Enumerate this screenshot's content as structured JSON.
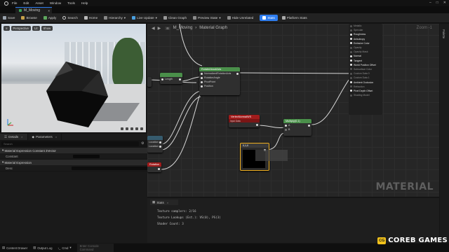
{
  "menu": {
    "items": [
      "File",
      "Edit",
      "Asset",
      "Window",
      "Tools",
      "Help"
    ]
  },
  "window": {
    "controls": [
      "–",
      "□",
      "✕"
    ]
  },
  "document_tab": {
    "label": "M_Moving",
    "close": "×"
  },
  "toolbar": {
    "save": "Save",
    "browse": "Browse",
    "apply": "Apply",
    "search": "Search",
    "home": "Home",
    "hierarchy": "Hierarchy",
    "live_update": "Live Update",
    "clean_graph": "Clean Graph",
    "preview_state": "Preview State",
    "hide_unrelated": "Hide Unrelated",
    "stats": "Stats",
    "platform_stats": "Platform Stats"
  },
  "viewport": {
    "perspective": "Perspective",
    "lit": "Lit",
    "show": "Show"
  },
  "details": {
    "tab_details": "Details",
    "tab_parameters": "Parameters",
    "search_placeholder": "Search",
    "section1": "Material Expression Constant 3Vector",
    "row_constant": "Constant",
    "section2": "Material Expression",
    "row_desc": "Desc"
  },
  "graph": {
    "breadcrumb_root": "M_Moving",
    "breadcrumb_sep": "›",
    "title": "Material Graph",
    "zoom": "Zoom -1",
    "watermark": "MATERIAL",
    "rotate_node": {
      "title": "RotateAboutAxis",
      "pins": [
        "NormalizedRotationAxis",
        "RotationAngle",
        "PivotPoint",
        "Position"
      ]
    },
    "small_node_out": "Length",
    "vertex_node": {
      "title": "VertexNormalWS",
      "subtitle": "Input Data"
    },
    "multiply_node": {
      "title": "Multiply(0,1)",
      "pins": [
        "A",
        "B"
      ]
    },
    "const_node": {
      "label": "0,1,0"
    },
    "left_pin_top": "Location",
    "left_pin_bottom": "Location",
    "left_pin_3": "Rotation",
    "result": {
      "pins": [
        {
          "label": "Metallic",
          "on": false
        },
        {
          "label": "Specular",
          "on": false
        },
        {
          "label": "Roughness",
          "on": true
        },
        {
          "label": "Anisotropy",
          "on": true
        },
        {
          "label": "Emissive Color",
          "on": true
        },
        {
          "label": "Opacity",
          "on": false
        },
        {
          "label": "Opacity Mask",
          "on": false
        },
        {
          "label": "Normal",
          "on": true
        },
        {
          "label": "Tangent",
          "on": true
        },
        {
          "label": "World Position Offset",
          "on": true
        },
        {
          "label": "Subsurface Color",
          "on": false
        },
        {
          "label": "Custom Data 0",
          "on": false
        },
        {
          "label": "Custom Data 1",
          "on": false
        },
        {
          "label": "Ambient Occlusion",
          "on": true
        },
        {
          "label": "Refraction",
          "on": false
        },
        {
          "label": "Pixel Depth Offset",
          "on": true
        },
        {
          "label": "Shading Model",
          "on": false
        }
      ]
    }
  },
  "side_strip": {
    "label": "Palette"
  },
  "stats": {
    "tab": "Stats",
    "lines": [
      "Texture samplers: 2/16",
      "Texture Lookups (Est.): VS(0), PS(3)",
      "Shader Count: 3"
    ]
  },
  "statusbar": {
    "content_drawer": "Content Drawer",
    "output_log": "Output Log",
    "cmd": "Cmd",
    "cmd_placeholder": "Enter Console Command"
  },
  "branding": {
    "badge": "CG",
    "text": "COREB GAMES"
  },
  "colors": {
    "accent": "#2e7df0",
    "rotate_title": "#4a8f4a",
    "vertex_title": "#a11c1c",
    "multiply_title": "#4a8f4a",
    "const_border": "#f0b020",
    "wire": "#d8d8d8",
    "badge": "#f2c21b"
  }
}
